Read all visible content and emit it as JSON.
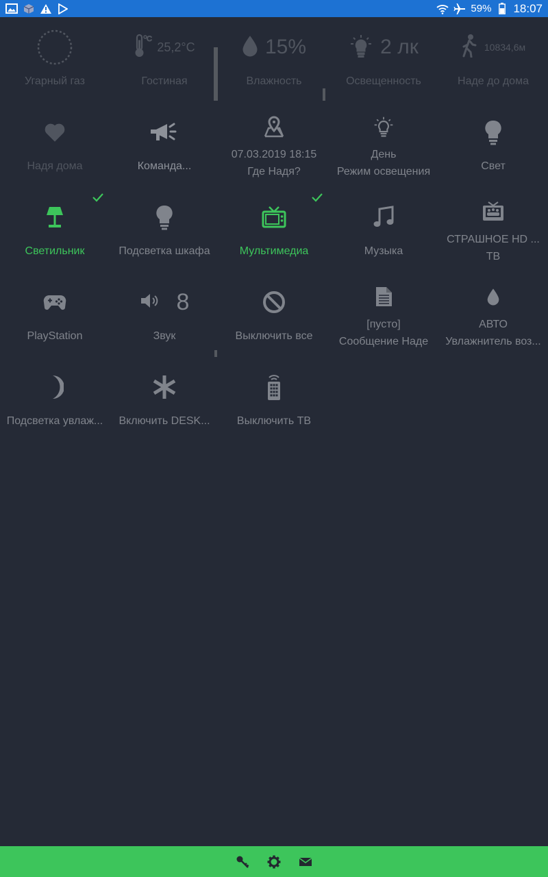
{
  "status_bar": {
    "battery": "59%",
    "time": "18:07",
    "left_icons": [
      "image-icon",
      "cube-app-icon",
      "warning-icon",
      "play-store-icon"
    ],
    "right_icons": [
      "wifi-icon",
      "airplane-icon",
      "battery-icon"
    ]
  },
  "sensors": [
    {
      "label": "Угарный газ",
      "value": "",
      "icon": "ring-icon"
    },
    {
      "label": "Гостиная",
      "value": "25,2°C",
      "icon": "thermometer-icon"
    },
    {
      "label": "Влажность",
      "value": "15%",
      "icon": "drop-icon"
    },
    {
      "label": "Освещенность",
      "value": "2 лк",
      "icon": "bulb-rays-icon"
    },
    {
      "label": "Наде до дома",
      "value": "10834,6м",
      "icon": "walking-icon"
    }
  ],
  "tiles_row2": [
    {
      "label": "Надя дома",
      "icon": "heart-icon"
    },
    {
      "label": "Команда...",
      "icon": "megaphone-icon"
    },
    {
      "line1": "07.03.2019 18:15",
      "line2": "Где Надя?",
      "icon": "map-pin-icon"
    },
    {
      "line1": "День",
      "line2": "Режим освещения",
      "icon": "bulb-rays-icon"
    },
    {
      "label": "Свет",
      "icon": "bulb-icon"
    }
  ],
  "tiles_row3": [
    {
      "label": "Светильник",
      "icon": "lamp-icon",
      "active": true
    },
    {
      "label": "Подсветка шкафа",
      "icon": "bulb-icon"
    },
    {
      "label": "Мультимедиа",
      "icon": "tv-icon",
      "active": true
    },
    {
      "label": "Музыка",
      "icon": "music-note-icon"
    },
    {
      "line1": "СТРАШНОЕ HD ...",
      "line2": "ТВ",
      "icon": "tv-channel-icon"
    }
  ],
  "tiles_row4": [
    {
      "label": "PlayStation",
      "icon": "gamepad-icon"
    },
    {
      "label": "Звук",
      "value": "8",
      "icon": "speaker-icon"
    },
    {
      "label": "Выключить все",
      "icon": "block-icon"
    },
    {
      "line1": "[пусто]",
      "line2": "Сообщение Наде",
      "icon": "document-icon"
    },
    {
      "line1": "АВТО",
      "line2": "Увлажнитель воз...",
      "icon": "drop-icon"
    }
  ],
  "tiles_row5": [
    {
      "label": "Подсветка увлаж...",
      "icon": "moon-icon"
    },
    {
      "label": "Включить DESK...",
      "icon": "asterisk-icon"
    },
    {
      "label": "Выключить ТВ",
      "icon": "remote-icon"
    }
  ],
  "bottom_bar": {
    "icons": [
      "key-icon",
      "gear-icon",
      "mail-icon"
    ]
  },
  "colors": {
    "background": "#252a36",
    "status_bar": "#1d72d3",
    "accent_green": "#3dc55b",
    "text_gray": "#80848c",
    "text_dim": "#50555f"
  }
}
